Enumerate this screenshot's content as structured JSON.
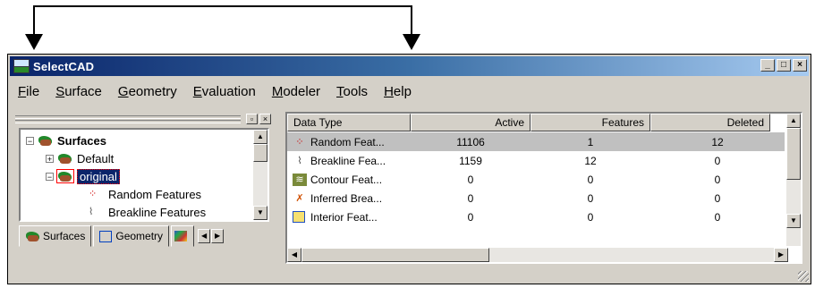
{
  "window": {
    "title": "SelectCAD",
    "controls": {
      "minimize": "_",
      "maximize": "□",
      "close": "×"
    }
  },
  "menu": [
    "File",
    "Surface",
    "Geometry",
    "Evaluation",
    "Modeler",
    "Tools",
    "Help"
  ],
  "tree": {
    "nodes": [
      {
        "label": "Surfaces",
        "expander": "−",
        "bold": true
      },
      {
        "label": "Default",
        "expander": "+"
      },
      {
        "label": "original",
        "expander": "−",
        "selected": true
      },
      {
        "label": "Random Features"
      },
      {
        "label": "Breakline Features"
      }
    ]
  },
  "tabs": [
    {
      "label": "Surfaces",
      "icon": "surface-icon"
    },
    {
      "label": "Geometry",
      "icon": "geometry-icon"
    }
  ],
  "grid": {
    "columns": [
      "Data Type",
      "Active",
      "Features",
      "Deleted"
    ],
    "rows": [
      {
        "type": "Random Feat...",
        "icon": "random-features-icon",
        "active": "11106",
        "features": "1",
        "deleted": "12",
        "selected": true
      },
      {
        "type": "Breakline Fea...",
        "icon": "breakline-icon",
        "active": "1159",
        "features": "12",
        "deleted": "0"
      },
      {
        "type": "Contour Feat...",
        "icon": "contour-icon",
        "active": "0",
        "features": "0",
        "deleted": "0"
      },
      {
        "type": "Inferred Brea...",
        "icon": "inferred-breakline-icon",
        "active": "0",
        "features": "0",
        "deleted": "0"
      },
      {
        "type": "Interior Feat...",
        "icon": "interior-icon",
        "active": "0",
        "features": "0",
        "deleted": "0"
      }
    ]
  },
  "colors": {
    "titlebar_start": "#0a246a",
    "titlebar_end": "#a6caf0",
    "face": "#d4d0c8",
    "selection": "#0a246a"
  }
}
